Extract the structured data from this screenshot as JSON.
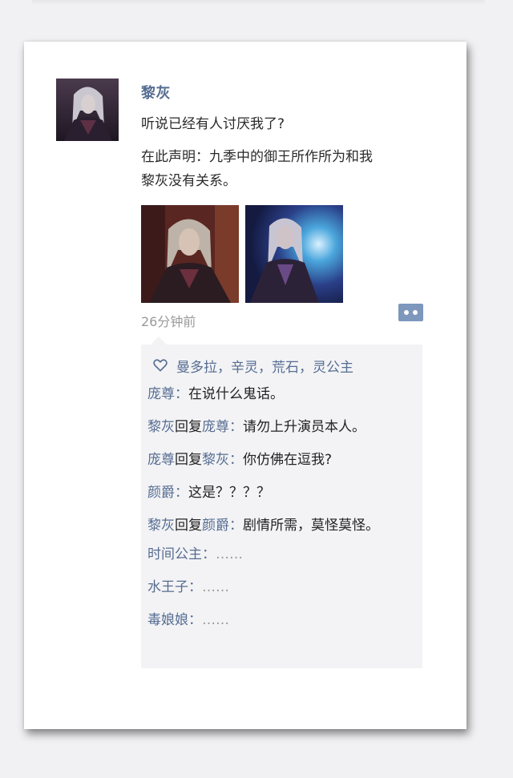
{
  "post": {
    "author": "黎灰",
    "lines": [
      "听说已经有人讨厌我了?",
      "在此声明：九季中的御王所作所为和我",
      "黎灰没有关系。"
    ],
    "time": "26分钟前"
  },
  "likes": {
    "icon": "heart-outline-icon",
    "names": "曼多拉，辛灵，荒石，灵公主"
  },
  "comments": [
    {
      "user": "庞尊",
      "reply_word": "",
      "reply_to": "",
      "sep": "：",
      "text": "在说什么鬼话。"
    },
    {
      "user": "黎灰",
      "reply_word": "回复",
      "reply_to": "庞尊",
      "sep": "：",
      "text": "请勿上升演员本人。"
    },
    {
      "user": "庞尊",
      "reply_word": "回复",
      "reply_to": "黎灰",
      "sep": "：",
      "text": "你仿佛在逗我?"
    },
    {
      "user": "颜爵",
      "reply_word": "",
      "reply_to": "",
      "sep": "：",
      "text": "这是？？？？"
    },
    {
      "user": "黎灰",
      "reply_word": "回复",
      "reply_to": "颜爵",
      "sep": "：",
      "text": "剧情所需，莫怪莫怪。"
    },
    {
      "user": "时间公主",
      "reply_word": "",
      "reply_to": "",
      "sep": "：",
      "text": "……"
    },
    {
      "user": "水王子",
      "reply_word": "",
      "reply_to": "",
      "sep": "：",
      "text": "……"
    },
    {
      "user": "毒娘娘",
      "reply_word": "",
      "reply_to": "",
      "sep": "：",
      "text": "……"
    }
  ],
  "colors": {
    "link": "#566d92",
    "comment_bg": "#f3f3f5",
    "more_button": "#7d97bd"
  }
}
